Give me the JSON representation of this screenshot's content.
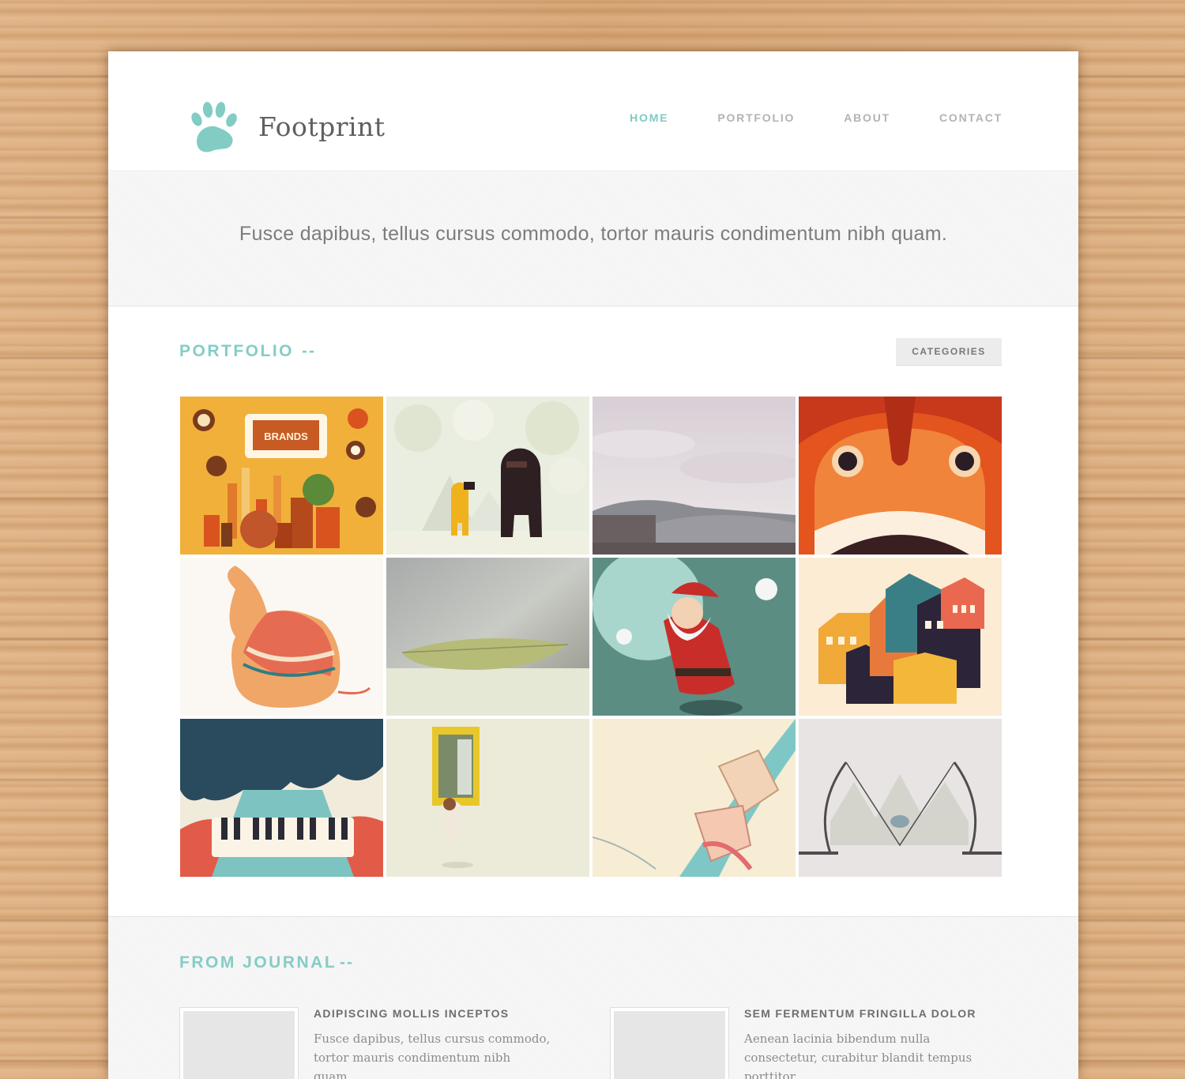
{
  "brand": {
    "name": "Footprint",
    "accent_color": "#7fcbc3",
    "logo_icon": "paw-print-icon"
  },
  "nav": {
    "items": [
      {
        "label": "HOME",
        "active": true
      },
      {
        "label": "PORTFOLIO",
        "active": false
      },
      {
        "label": "ABOUT",
        "active": false
      },
      {
        "label": "CONTACT",
        "active": false
      }
    ]
  },
  "hero": {
    "text": "Fusce dapibus, tellus cursus commodo, tortor mauris condimentum nibh quam."
  },
  "portfolio": {
    "title": "PORTFOLIO",
    "dash": "--",
    "categories_label": "CATEGORIES",
    "tiles": [
      {
        "label": "BRANDS",
        "subject": "brands infographic illustration"
      },
      {
        "subject": "monster in snowy forest illustration"
      },
      {
        "subject": "train wagon under cloudy sky photo"
      },
      {
        "subject": "orange monster face illustration"
      },
      {
        "subject": "elephant in patterned sweater illustration"
      },
      {
        "subject": "dry leaf macro photo"
      },
      {
        "subject": "santa claus illustration"
      },
      {
        "subject": "colorful houses illustration"
      },
      {
        "subject": "keyboard under cloud illustration"
      },
      {
        "subject": "figure climbing from wall door illustration"
      },
      {
        "subject": "abstract figure illustration"
      },
      {
        "subject": "circus tents tightrope illustration"
      }
    ]
  },
  "journal": {
    "title": "FROM JOURNAL",
    "dash": "--",
    "posts": [
      {
        "title": "ADIPISCING MOLLIS INCEPTOS",
        "excerpt": "Fusce dapibus, tellus cursus commodo, tortor mauris condimentum nibh quam."
      },
      {
        "title": "SEM FERMENTUM FRINGILLA DOLOR",
        "excerpt": "Aenean lacinia bibendum nulla consectetur, curabitur blandit tempus porttitor."
      }
    ]
  }
}
